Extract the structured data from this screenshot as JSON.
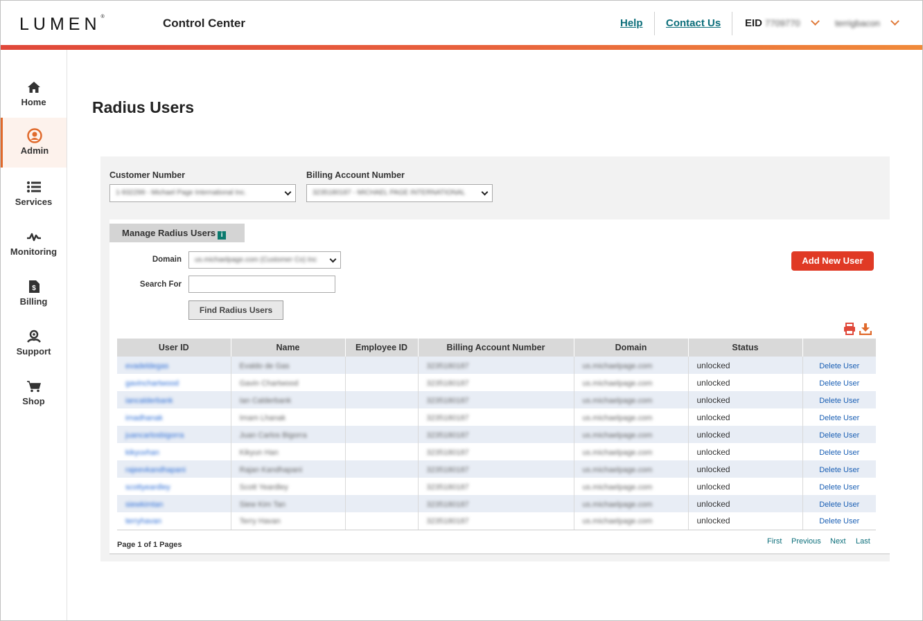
{
  "header": {
    "logo": "LUMEN",
    "app_title": "Control Center",
    "help_label": "Help",
    "contact_label": "Contact Us",
    "eid_label": "EID",
    "eid_value": "7709770",
    "username": "terrigbacon"
  },
  "sidebar": {
    "items": [
      {
        "label": "Home",
        "icon": "home-icon"
      },
      {
        "label": "Admin",
        "icon": "user-circle-icon",
        "active": true
      },
      {
        "label": "Services",
        "icon": "list-icon"
      },
      {
        "label": "Monitoring",
        "icon": "pulse-icon"
      },
      {
        "label": "Billing",
        "icon": "invoice-icon"
      },
      {
        "label": "Support",
        "icon": "support-icon"
      },
      {
        "label": "Shop",
        "icon": "cart-icon"
      }
    ]
  },
  "page": {
    "title": "Radius Users",
    "customer_number_label": "Customer Number",
    "customer_number_value": "1-932299 - Michael Page International Inc.",
    "billing_account_label": "Billing Account Number",
    "billing_account_value": "3235180187 - MICHAEL PAGE INTERNATIONAL",
    "tab_label": "Manage Radius Users",
    "domain_label": "Domain",
    "domain_value": "us.michaelpage.com (Customer Co) Inc",
    "search_label": "Search For",
    "search_value": "",
    "find_button": "Find Radius Users",
    "add_button": "Add New User"
  },
  "table": {
    "columns": [
      "User ID",
      "Name",
      "Employee ID",
      "Billing Account Number",
      "Domain",
      "Status",
      ""
    ],
    "rows": [
      {
        "user_id": "evadeldegas",
        "name": "Evaldo de Gas",
        "employee_id": "",
        "ban": "3235180187",
        "domain": "us.michaelpage.com",
        "status": "unlocked",
        "action": "Delete User"
      },
      {
        "user_id": "gavinchartwood",
        "name": "Gavin Chartwood",
        "employee_id": "",
        "ban": "3235180187",
        "domain": "us.michaelpage.com",
        "status": "unlocked",
        "action": "Delete User"
      },
      {
        "user_id": "iancalderbank",
        "name": "Ian Calderbank",
        "employee_id": "",
        "ban": "3235180187",
        "domain": "us.michaelpage.com",
        "status": "unlocked",
        "action": "Delete User"
      },
      {
        "user_id": "imadhanak",
        "name": "Imam Lhanak",
        "employee_id": "",
        "ban": "3235180187",
        "domain": "us.michaelpage.com",
        "status": "unlocked",
        "action": "Delete User"
      },
      {
        "user_id": "juancarlosbigorra",
        "name": "Juan Carlos Bigorra",
        "employee_id": "",
        "ban": "3235180187",
        "domain": "us.michaelpage.com",
        "status": "unlocked",
        "action": "Delete User"
      },
      {
        "user_id": "kikyuvhan",
        "name": "Kikyun Han",
        "employee_id": "",
        "ban": "3235180187",
        "domain": "us.michaelpage.com",
        "status": "unlocked",
        "action": "Delete User"
      },
      {
        "user_id": "rajeevkandhapani",
        "name": "Rajan Kandhapani",
        "employee_id": "",
        "ban": "3235180187",
        "domain": "us.michaelpage.com",
        "status": "unlocked",
        "action": "Delete User"
      },
      {
        "user_id": "scottyeardley",
        "name": "Scott Yeardley",
        "employee_id": "",
        "ban": "3235180187",
        "domain": "us.michaelpage.com",
        "status": "unlocked",
        "action": "Delete User"
      },
      {
        "user_id": "siewkimtan",
        "name": "Siew Kim Tan",
        "employee_id": "",
        "ban": "3235180187",
        "domain": "us.michaelpage.com",
        "status": "unlocked",
        "action": "Delete User"
      },
      {
        "user_id": "terryhavan",
        "name": "Terry Havan",
        "employee_id": "",
        "ban": "3235180187",
        "domain": "us.michaelpage.com",
        "status": "unlocked",
        "action": "Delete User"
      }
    ]
  },
  "pager": {
    "summary": "Page 1 of 1 Pages",
    "first": "First",
    "previous": "Previous",
    "next": "Next",
    "last": "Last"
  },
  "colors": {
    "accent": "#e03a25",
    "link": "#0b6e7a",
    "row_alt": "#e8edf5"
  }
}
